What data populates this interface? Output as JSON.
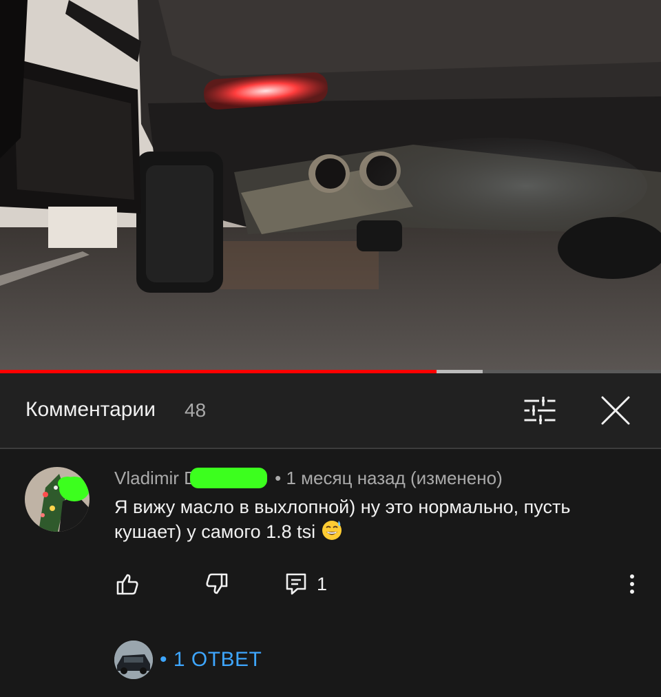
{
  "video": {
    "description_icon": "video-frame-car-exhaust",
    "progress_played_fraction": 0.66,
    "progress_buffered_fraction": 0.73
  },
  "comments": {
    "title": "Комментарии",
    "count": "48",
    "filter_icon": "sort-filter-icon",
    "close_icon": "close-icon"
  },
  "comment": {
    "author": "Vladimir D",
    "time": "• 1 месяц назад (изменено)",
    "text": "Я вижу масло в выхлопной) ну это нормально, пусть кушает) у самого 1.8 tsi",
    "emoji": "😅",
    "replies_count": "1",
    "reply_link": "• 1 ОТВЕТ"
  },
  "colors": {
    "background": "#212121",
    "comment_background": "#181818",
    "accent_link": "#3ea6ff",
    "progress_red": "#ff0000",
    "redaction": "#3cff1e"
  }
}
